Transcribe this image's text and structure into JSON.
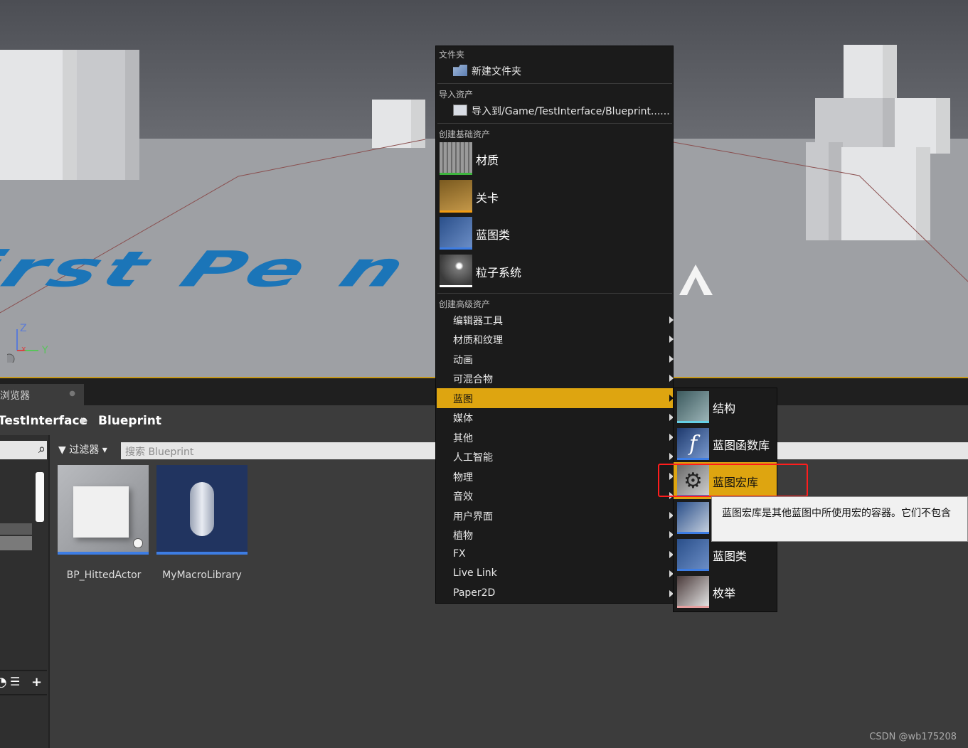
{
  "viewport": {
    "floor_text": "irst Pe    n Te",
    "axis_z": "Z",
    "axis_y": "Y",
    "axis_x": "x"
  },
  "content_browser": {
    "tab_label": "浏览器",
    "path": [
      "TestInterface",
      "Blueprint"
    ],
    "filter_label": "过滤器",
    "search_placeholder": "搜索 Blueprint",
    "assets": [
      {
        "name": "BP_HittedActor"
      },
      {
        "name": "MyMacroLibrary"
      }
    ]
  },
  "context_menu": {
    "section_folder": "文件夹",
    "new_folder": "新建文件夹",
    "section_import": "导入资产",
    "import_to": "导入到/Game/TestInterface/Blueprint......",
    "section_basic": "创建基础资产",
    "basic_items": [
      {
        "label": "材质",
        "accent": "#3db53d"
      },
      {
        "label": "关卡",
        "accent": "#f39c12"
      },
      {
        "label": "蓝图类",
        "accent": "#3d7de4"
      },
      {
        "label": "粒子系统",
        "accent": "#ffffff"
      }
    ],
    "section_advanced": "创建高级资产",
    "advanced_items": [
      {
        "label": "编辑器工具"
      },
      {
        "label": "材质和纹理"
      },
      {
        "label": "动画"
      },
      {
        "label": "可混合物"
      },
      {
        "label": "蓝图",
        "active": true
      },
      {
        "label": "媒体"
      },
      {
        "label": "其他"
      },
      {
        "label": "人工智能"
      },
      {
        "label": "物理"
      },
      {
        "label": "音效"
      },
      {
        "label": "用户界面"
      },
      {
        "label": "植物"
      },
      {
        "label": "FX"
      },
      {
        "label": "Live Link"
      },
      {
        "label": "Paper2D"
      }
    ],
    "active_color": "#dea510"
  },
  "submenu": {
    "items": [
      {
        "label": "结构",
        "accent": "#66d0e6",
        "icon": "struct-icon"
      },
      {
        "label": "蓝图函数库",
        "accent": "#3d7de4",
        "icon": "function-library-icon"
      },
      {
        "label": "蓝图宏库",
        "accent": "#3d7de4",
        "icon": "macro-library-icon",
        "active": true
      },
      {
        "label": "",
        "accent": "#3d7de4",
        "icon": "blueprint-interface-icon"
      },
      {
        "label": "蓝图类",
        "accent": "#3d7de4",
        "icon": "blueprint-class-icon"
      },
      {
        "label": "枚举",
        "accent": "#e6a0a0",
        "icon": "enum-icon"
      }
    ]
  },
  "tooltip": {
    "text": "蓝图宏库是其他蓝图中所使用宏的容器。它们不包含"
  },
  "highlight_color": "#ff1d1d",
  "watermark": "CSDN @wb175208"
}
